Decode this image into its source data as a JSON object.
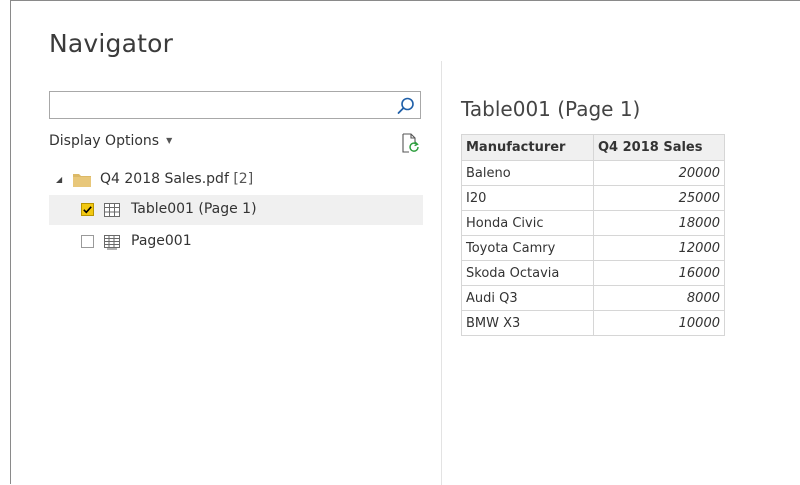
{
  "dialog": {
    "title": "Navigator"
  },
  "search": {
    "value": "",
    "placeholder": ""
  },
  "display_options": {
    "label": "Display Options"
  },
  "tree": {
    "folder": {
      "name": "Q4 2018 Sales.pdf",
      "count": "[2]"
    },
    "items": [
      {
        "label": "Table001 (Page 1)",
        "checked": true,
        "selected": true
      },
      {
        "label": "Page001",
        "checked": false,
        "selected": false
      }
    ]
  },
  "preview": {
    "title": "Table001 (Page 1)",
    "columns": [
      "Manufacturer",
      "Q4 2018 Sales"
    ],
    "rows": [
      [
        "Baleno",
        "20000"
      ],
      [
        "I20",
        "25000"
      ],
      [
        "Honda Civic",
        "18000"
      ],
      [
        "Toyota Camry",
        "12000"
      ],
      [
        "Skoda Octavia",
        "16000"
      ],
      [
        "Audi Q3",
        "8000"
      ],
      [
        "BMW X3",
        "10000"
      ]
    ]
  },
  "colors": {
    "checkbox_accent": "#f2c811",
    "folder": "#dcb967",
    "selection_bg": "#f0f0f0",
    "refresh_green": "#2e9e3e"
  },
  "icons": [
    "search-icon",
    "chevron-down-icon",
    "refresh-icon",
    "expand-triangle-icon",
    "folder-icon",
    "table-icon",
    "page-table-icon",
    "checkmark-icon"
  ]
}
